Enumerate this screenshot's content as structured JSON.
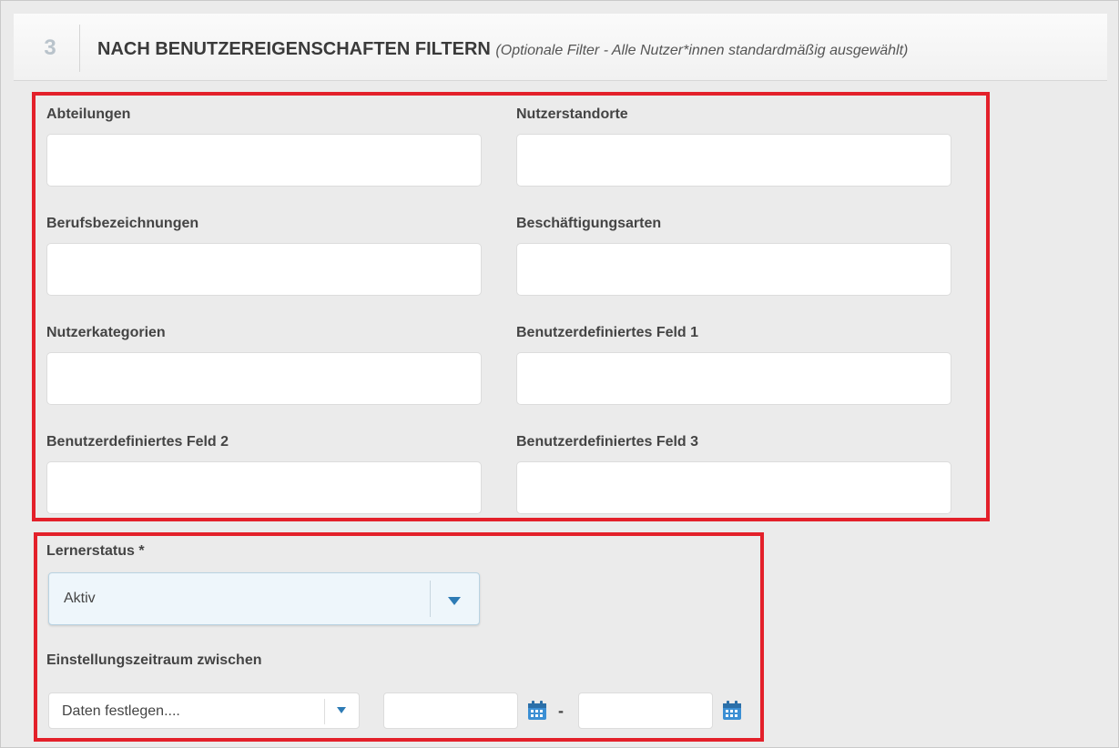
{
  "header": {
    "step_number": "3",
    "title": "NACH BENUTZEREIGENSCHAFTEN FILTERN",
    "subtitle": "(Optionale Filter - Alle Nutzer*innen standardmäßig ausgewählt)"
  },
  "filters": {
    "abteilungen": {
      "label": "Abteilungen",
      "value": ""
    },
    "nutzerstandorte": {
      "label": "Nutzerstandorte",
      "value": ""
    },
    "berufsbezeichnungen": {
      "label": "Berufsbezeichnungen",
      "value": ""
    },
    "beschaeftigungsarten": {
      "label": "Beschäftigungsarten",
      "value": ""
    },
    "nutzerkategorien": {
      "label": "Nutzerkategorien",
      "value": ""
    },
    "custom1": {
      "label": "Benutzerdefiniertes Feld 1",
      "value": ""
    },
    "custom2": {
      "label": "Benutzerdefiniertes Feld 2",
      "value": ""
    },
    "custom3": {
      "label": "Benutzerdefiniertes Feld 3",
      "value": ""
    }
  },
  "lernerstatus": {
    "label": "Lernerstatus *",
    "selected": "Aktiv"
  },
  "einstellungszeitraum": {
    "label": "Einstellungszeitraum zwischen",
    "preset_selected": "Daten festlegen....",
    "separator": "-",
    "from_value": "",
    "to_value": ""
  },
  "icons": {
    "dropdown": "chevron-down-icon",
    "calendar": "calendar-icon"
  },
  "colors": {
    "highlight_border": "#e3202a",
    "accent": "#2d7bb5",
    "panel_background": "#ebebeb"
  }
}
